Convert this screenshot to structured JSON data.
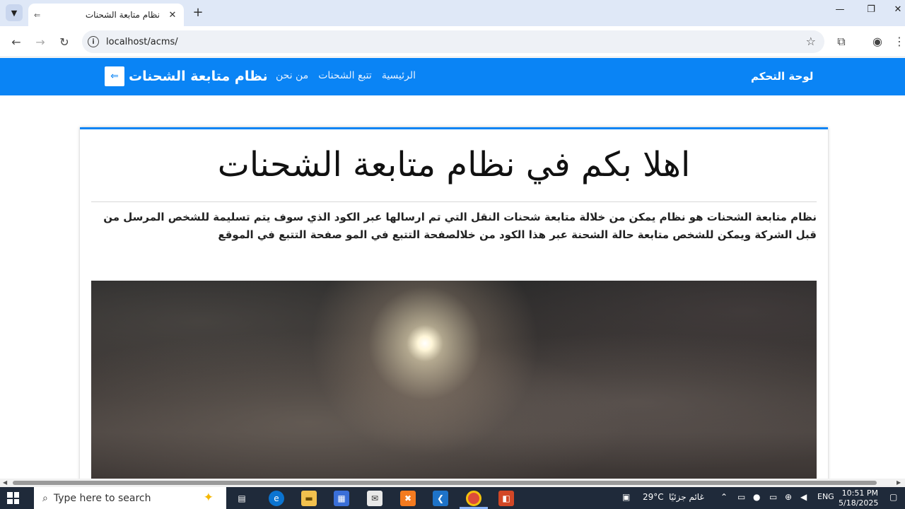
{
  "browser": {
    "tab_title": "نظام متابعة الشحنات",
    "url": "localhost/acms/"
  },
  "navbar": {
    "brand": "نظام متابعة الشحنات",
    "links": [
      "الرئيسية",
      "تتبع الشحنات",
      "من نحن"
    ],
    "dashboard": "لوحة التحكم"
  },
  "hero": {
    "title": "اهلا بكم في نظام متابعة الشحنات",
    "description": "نظام متابعة الشحنات هو نظام يمكن من خلالة متابعة شحنات النقل التي تم ارسالها عبر الكود الذي سوف يتم تسليمة للشخص المرسل من قبل الشركة ويمكن للشخص متابعة حالة الشحنة عبر هذا الكود من خلالصفحة التتبع في المو صفحة التتبع في الموقع"
  },
  "taskbar": {
    "search_placeholder": "Type here to search",
    "weather_temp": "29°C",
    "weather_desc": "غائم جزئيًا",
    "language": "ENG",
    "time": "10:51 PM",
    "date": "5/18/2025"
  },
  "colors": {
    "navbar": "#0a84f5",
    "taskbar": "#1f2a3a"
  }
}
